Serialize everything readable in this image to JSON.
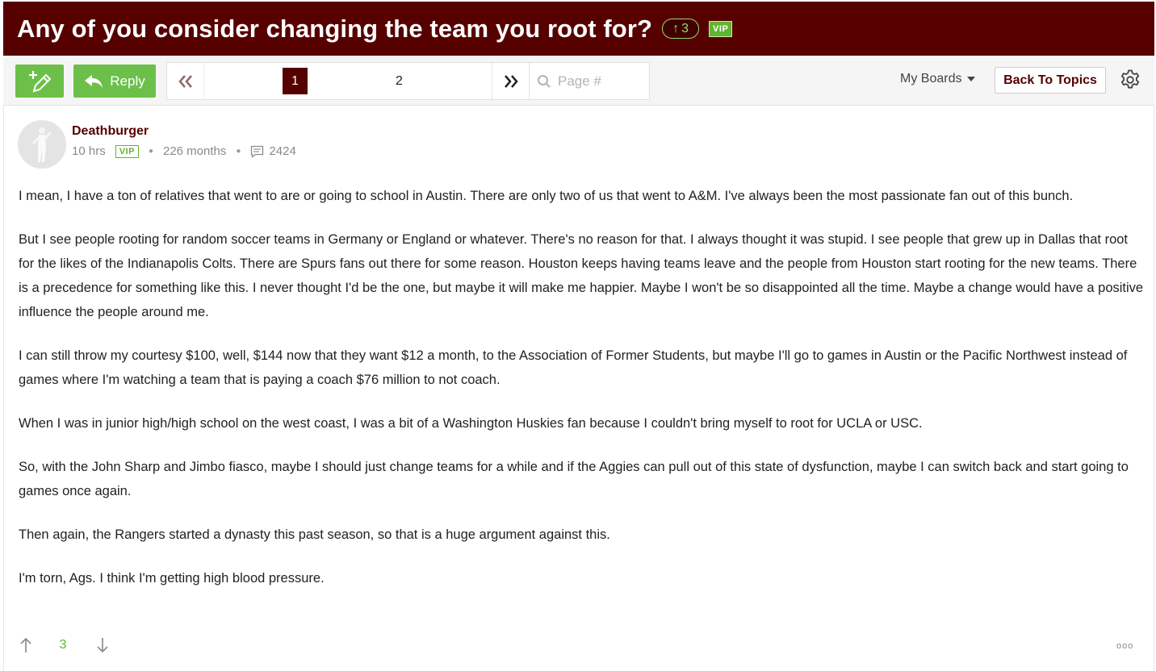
{
  "thread": {
    "title": "Any of you consider changing the team you root for?",
    "vote_count": "3",
    "vip_label": "VIP"
  },
  "toolbar": {
    "reply_label": "Reply",
    "pages": [
      "1",
      "2"
    ],
    "current_page": "1",
    "page_placeholder": "Page #",
    "my_boards_label": "My Boards",
    "back_label": "Back To Topics"
  },
  "post": {
    "author": "Deathburger",
    "time": "10 hrs",
    "vip_label": "VIP",
    "tenure": "226 months",
    "post_count": "2424",
    "paragraphs": [
      "I mean, I have a ton of relatives that went to are or going to school in Austin. There are only two of us that went to A&M. I've always been the most passionate fan out of this bunch.",
      "But I see people rooting for random soccer teams in Germany or England or whatever. There's no reason for that. I always thought it was stupid. I see people that grew up in Dallas that root for the likes of the Indianapolis Colts. There are Spurs fans out there for some reason. Houston keeps having teams leave and the people from Houston start rooting for the new teams. There is a precedence for something like this. I never thought I'd be the one, but maybe it will make me happier. Maybe I won't be so disappointed all the time. Maybe a change would have a positive influence the people around me.",
      "I can still throw my courtesy $100, well, $144 now that they want $12 a month, to the Association of Former Students, but maybe I'll go to games in Austin or the Pacific Northwest instead of games where I'm watching a team that is paying a coach $76 million to not coach.",
      "When I was in junior high/high school on the west coast, I was a bit of a Washington Huskies fan because I couldn't bring myself to root for UCLA or USC.",
      "So, with the John Sharp and Jimbo fiasco, maybe I should just change teams for a while and if the Aggies can pull out of this state of dysfunction, maybe I can switch back and start going to games once again.",
      "Then again, the Rangers started a dynasty this past season, so that is a huge argument against this.",
      "I'm torn, Ags. I think I'm getting high blood pressure."
    ],
    "score": "3",
    "more_label": "ooo"
  },
  "colors": {
    "maroon": "#560000",
    "green": "#6cc04a",
    "vip_green": "#62b32e"
  }
}
